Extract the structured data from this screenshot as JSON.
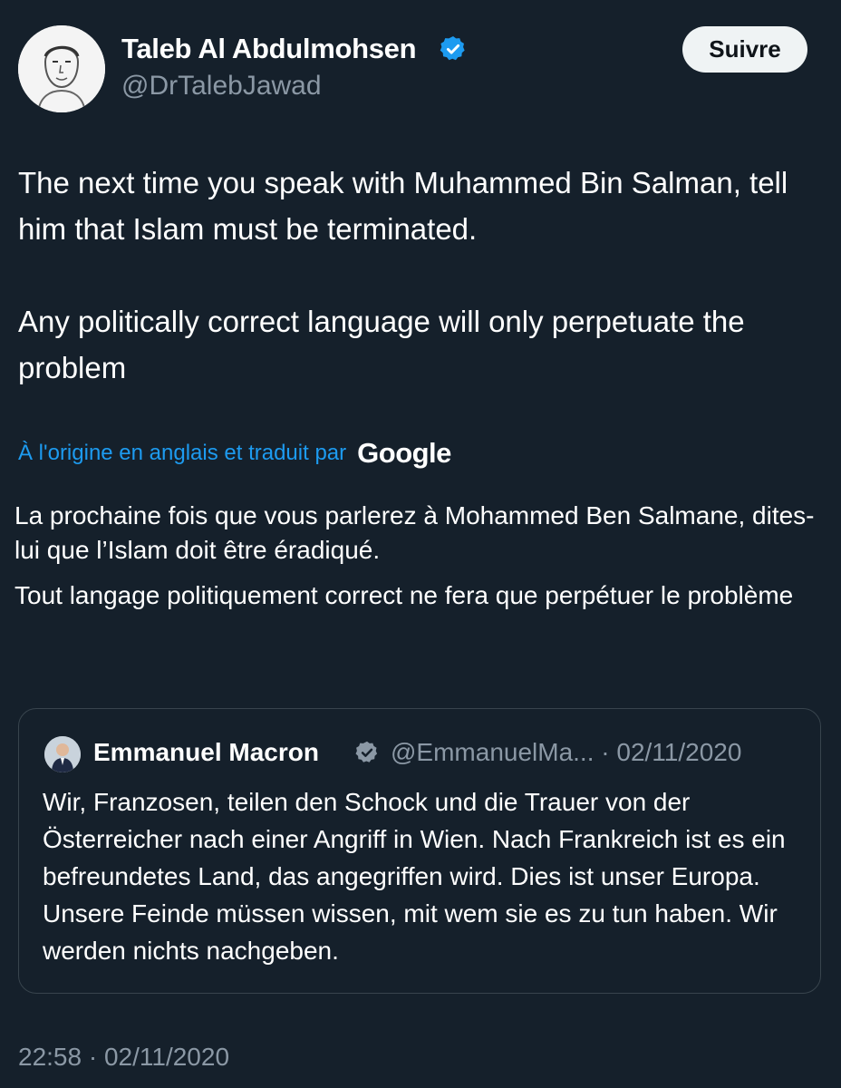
{
  "author": {
    "name": "Taleb Al Abdulmohsen",
    "handle": "@DrTalebJawad",
    "verified": true
  },
  "follow_button": {
    "label": "Suivre"
  },
  "tweet": {
    "paragraphs": [
      "The next time you speak with Muhammed Bin Salman, tell him that Islam must be terminated.",
      "Any politically correct language will only perpetuate the problem"
    ],
    "translation": {
      "notice": "À l'origine en anglais et traduit par",
      "provider": "Google",
      "paragraphs": [
        "La prochaine fois que vous parlerez à Mohammed Ben Salmane, dites-lui que l’Islam doit être éradiqué.",
        "Tout langage politiquement correct ne fera que perpétuer le problème"
      ]
    },
    "timestamp": "22:58 · 02/11/2020"
  },
  "quoted_tweet": {
    "name": "Emmanuel Macron",
    "handle_date": "@EmmanuelMa... · 02/11/2020",
    "verified": true,
    "text": "Wir, Franzosen, teilen den Schock und die Trauer von der Österreicher nach einer Angriff in Wien. Nach Frankreich ist es ein befreundetes Land, das angegriffen wird. Dies ist unser Europa. Unsere Feinde müssen wissen, mit wem sie es zu tun haben. Wir werden nichts nachgeben."
  },
  "colors": {
    "background": "#15202b",
    "text_primary": "#ffffff",
    "text_secondary": "#8b98a5",
    "link": "#1d9bf0",
    "verified_badge": "#1d9bf0",
    "border": "#38444d",
    "follow_button_bg": "#eff3f4"
  },
  "icons": {
    "verified": "verified-badge-icon",
    "author_avatar": "sketch-portrait-avatar",
    "quote_avatar": "portrait-avatar"
  }
}
